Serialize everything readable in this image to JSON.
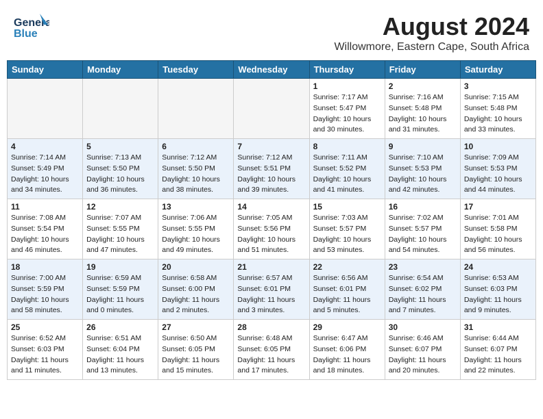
{
  "header": {
    "logo_line1": "General",
    "logo_line2": "Blue",
    "month": "August 2024",
    "location": "Willowmore, Eastern Cape, South Africa"
  },
  "days_of_week": [
    "Sunday",
    "Monday",
    "Tuesday",
    "Wednesday",
    "Thursday",
    "Friday",
    "Saturday"
  ],
  "weeks": [
    [
      {
        "day": "",
        "info": ""
      },
      {
        "day": "",
        "info": ""
      },
      {
        "day": "",
        "info": ""
      },
      {
        "day": "",
        "info": ""
      },
      {
        "day": "1",
        "info": "Sunrise: 7:17 AM\nSunset: 5:47 PM\nDaylight: 10 hours\nand 30 minutes."
      },
      {
        "day": "2",
        "info": "Sunrise: 7:16 AM\nSunset: 5:48 PM\nDaylight: 10 hours\nand 31 minutes."
      },
      {
        "day": "3",
        "info": "Sunrise: 7:15 AM\nSunset: 5:48 PM\nDaylight: 10 hours\nand 33 minutes."
      }
    ],
    [
      {
        "day": "4",
        "info": "Sunrise: 7:14 AM\nSunset: 5:49 PM\nDaylight: 10 hours\nand 34 minutes."
      },
      {
        "day": "5",
        "info": "Sunrise: 7:13 AM\nSunset: 5:50 PM\nDaylight: 10 hours\nand 36 minutes."
      },
      {
        "day": "6",
        "info": "Sunrise: 7:12 AM\nSunset: 5:50 PM\nDaylight: 10 hours\nand 38 minutes."
      },
      {
        "day": "7",
        "info": "Sunrise: 7:12 AM\nSunset: 5:51 PM\nDaylight: 10 hours\nand 39 minutes."
      },
      {
        "day": "8",
        "info": "Sunrise: 7:11 AM\nSunset: 5:52 PM\nDaylight: 10 hours\nand 41 minutes."
      },
      {
        "day": "9",
        "info": "Sunrise: 7:10 AM\nSunset: 5:53 PM\nDaylight: 10 hours\nand 42 minutes."
      },
      {
        "day": "10",
        "info": "Sunrise: 7:09 AM\nSunset: 5:53 PM\nDaylight: 10 hours\nand 44 minutes."
      }
    ],
    [
      {
        "day": "11",
        "info": "Sunrise: 7:08 AM\nSunset: 5:54 PM\nDaylight: 10 hours\nand 46 minutes."
      },
      {
        "day": "12",
        "info": "Sunrise: 7:07 AM\nSunset: 5:55 PM\nDaylight: 10 hours\nand 47 minutes."
      },
      {
        "day": "13",
        "info": "Sunrise: 7:06 AM\nSunset: 5:55 PM\nDaylight: 10 hours\nand 49 minutes."
      },
      {
        "day": "14",
        "info": "Sunrise: 7:05 AM\nSunset: 5:56 PM\nDaylight: 10 hours\nand 51 minutes."
      },
      {
        "day": "15",
        "info": "Sunrise: 7:03 AM\nSunset: 5:57 PM\nDaylight: 10 hours\nand 53 minutes."
      },
      {
        "day": "16",
        "info": "Sunrise: 7:02 AM\nSunset: 5:57 PM\nDaylight: 10 hours\nand 54 minutes."
      },
      {
        "day": "17",
        "info": "Sunrise: 7:01 AM\nSunset: 5:58 PM\nDaylight: 10 hours\nand 56 minutes."
      }
    ],
    [
      {
        "day": "18",
        "info": "Sunrise: 7:00 AM\nSunset: 5:59 PM\nDaylight: 10 hours\nand 58 minutes."
      },
      {
        "day": "19",
        "info": "Sunrise: 6:59 AM\nSunset: 5:59 PM\nDaylight: 11 hours\nand 0 minutes."
      },
      {
        "day": "20",
        "info": "Sunrise: 6:58 AM\nSunset: 6:00 PM\nDaylight: 11 hours\nand 2 minutes."
      },
      {
        "day": "21",
        "info": "Sunrise: 6:57 AM\nSunset: 6:01 PM\nDaylight: 11 hours\nand 3 minutes."
      },
      {
        "day": "22",
        "info": "Sunrise: 6:56 AM\nSunset: 6:01 PM\nDaylight: 11 hours\nand 5 minutes."
      },
      {
        "day": "23",
        "info": "Sunrise: 6:54 AM\nSunset: 6:02 PM\nDaylight: 11 hours\nand 7 minutes."
      },
      {
        "day": "24",
        "info": "Sunrise: 6:53 AM\nSunset: 6:03 PM\nDaylight: 11 hours\nand 9 minutes."
      }
    ],
    [
      {
        "day": "25",
        "info": "Sunrise: 6:52 AM\nSunset: 6:03 PM\nDaylight: 11 hours\nand 11 minutes."
      },
      {
        "day": "26",
        "info": "Sunrise: 6:51 AM\nSunset: 6:04 PM\nDaylight: 11 hours\nand 13 minutes."
      },
      {
        "day": "27",
        "info": "Sunrise: 6:50 AM\nSunset: 6:05 PM\nDaylight: 11 hours\nand 15 minutes."
      },
      {
        "day": "28",
        "info": "Sunrise: 6:48 AM\nSunset: 6:05 PM\nDaylight: 11 hours\nand 17 minutes."
      },
      {
        "day": "29",
        "info": "Sunrise: 6:47 AM\nSunset: 6:06 PM\nDaylight: 11 hours\nand 18 minutes."
      },
      {
        "day": "30",
        "info": "Sunrise: 6:46 AM\nSunset: 6:07 PM\nDaylight: 11 hours\nand 20 minutes."
      },
      {
        "day": "31",
        "info": "Sunrise: 6:44 AM\nSunset: 6:07 PM\nDaylight: 11 hours\nand 22 minutes."
      }
    ]
  ]
}
